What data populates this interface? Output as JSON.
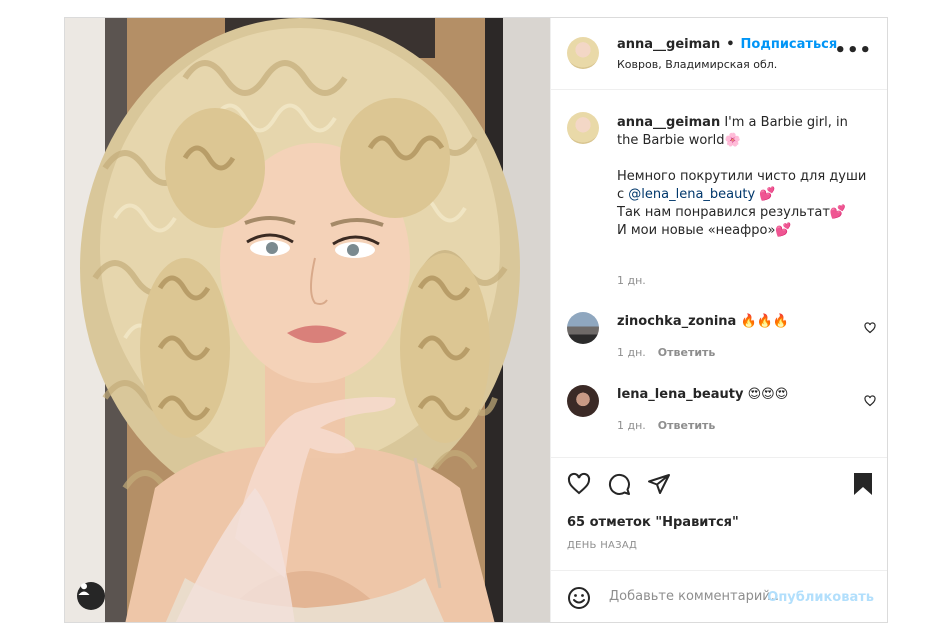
{
  "post": {
    "author": "anna__geiman",
    "separator": "•",
    "follow_label": "Подписаться",
    "location": "Ковров, Владимирская обл.",
    "more_icon": "•••",
    "caption": {
      "username": "anna__geiman",
      "text_line1": " I'm a Barbie girl, in the Barbie world🌸",
      "text_line2": "Немного покрутили чисто для души с ",
      "mention": "@lena_lena_beauty",
      "text_line3": " 💕\nТак нам понравился результат💕\nИ мои новые «неафро»💕",
      "time": "1 дн."
    },
    "comments": [
      {
        "username": "zinochka_zonina",
        "text": "🔥🔥🔥",
        "time": "1 дн.",
        "reply_label": "Ответить"
      },
      {
        "username": "lena_lena_beauty",
        "text": "😍😍😍",
        "time": "1 дн.",
        "reply_label": "Ответить"
      }
    ],
    "likes_text": "65 отметок \"Нравится\"",
    "date_text": "ДЕНЬ НАЗАД",
    "comment_placeholder": "Добавьте комментарий...",
    "publish_label": "Опубликовать"
  },
  "icons": {
    "like": "heart-icon",
    "comment": "comment-icon",
    "share": "paper-plane-icon",
    "save": "bookmark-icon",
    "emoji": "emoji-icon",
    "user_tag": "user-tag-icon"
  },
  "colors": {
    "accent": "#0095f6",
    "text": "#262626",
    "muted": "#8e8e8e",
    "border": "#dbdbdb"
  }
}
